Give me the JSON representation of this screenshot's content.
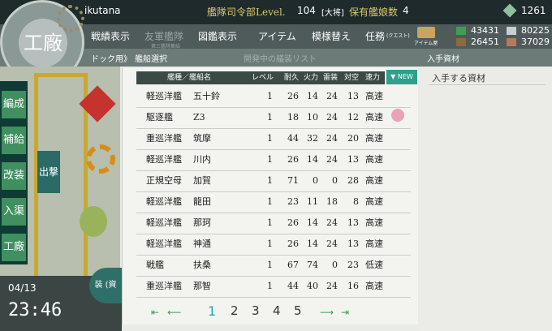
{
  "header": {
    "username": "ikutana",
    "hq_level_label": "艦隊司令部Level.",
    "hq_level_value": "104",
    "rank": "[大将]",
    "ship_count_label": "保有艦娘数",
    "ship_count_value": "4",
    "coins": "1261",
    "resources": {
      "fuel": "43431",
      "ammo": "26451",
      "steel": "80225",
      "bauxite": "37029"
    }
  },
  "side_badge": "工廠",
  "menu": {
    "items": [
      "戦績表示",
      "友軍艦隊",
      "図鑑表示",
      "アイテム",
      "模様替え",
      "任務"
    ],
    "quest_suffix": "(クエスト)",
    "friend_sub": "第三艦隊集結",
    "item_shop": "アイテム屋"
  },
  "subbar": {
    "breadcrumb_prefix": "ドック用》",
    "breadcrumb_current": "艦船選択",
    "center_hint": "開発中の艤装リスト",
    "right_title": "入手資材"
  },
  "left_nav": [
    "編成",
    "補給",
    "改装",
    "入渠",
    "工廠"
  ],
  "left_sub": "出撃",
  "date": "04/13",
  "time": "23:46",
  "equip_btn": "装 (資",
  "table": {
    "headers": {
      "name": "艦種／艦船名",
      "level": "レベル",
      "hp": "耐久",
      "fp": "火力",
      "tp": "雷装",
      "aa": "対空",
      "speed": "速力"
    },
    "sort_label": "NEW",
    "rows": [
      {
        "type": "軽巡洋艦",
        "name": "五十鈴",
        "level": "1",
        "hp": "26",
        "fp": "14",
        "tp": "24",
        "aa": "13",
        "speed": "高速"
      },
      {
        "type": "駆逐艦",
        "name": "Z3",
        "level": "1",
        "hp": "18",
        "fp": "10",
        "tp": "24",
        "aa": "12",
        "speed": "高速"
      },
      {
        "type": "重巡洋艦",
        "name": "筑摩",
        "level": "1",
        "hp": "44",
        "fp": "32",
        "tp": "24",
        "aa": "20",
        "speed": "高速"
      },
      {
        "type": "軽巡洋艦",
        "name": "川内",
        "level": "1",
        "hp": "26",
        "fp": "14",
        "tp": "24",
        "aa": "13",
        "speed": "高速"
      },
      {
        "type": "正規空母",
        "name": "加賀",
        "level": "1",
        "hp": "71",
        "fp": "0",
        "tp": "0",
        "aa": "28",
        "speed": "高速"
      },
      {
        "type": "軽巡洋艦",
        "name": "龍田",
        "level": "1",
        "hp": "23",
        "fp": "11",
        "tp": "18",
        "aa": "8",
        "speed": "高速"
      },
      {
        "type": "軽巡洋艦",
        "name": "那珂",
        "level": "1",
        "hp": "26",
        "fp": "14",
        "tp": "24",
        "aa": "13",
        "speed": "高速"
      },
      {
        "type": "軽巡洋艦",
        "name": "神通",
        "level": "1",
        "hp": "26",
        "fp": "14",
        "tp": "24",
        "aa": "13",
        "speed": "高速"
      },
      {
        "type": "戦艦",
        "name": "扶桑",
        "level": "1",
        "hp": "67",
        "fp": "74",
        "tp": "0",
        "aa": "23",
        "speed": "低速"
      },
      {
        "type": "重巡洋艦",
        "name": "那智",
        "level": "1",
        "hp": "44",
        "fp": "40",
        "tp": "24",
        "aa": "16",
        "speed": "高速"
      }
    ]
  },
  "pager": {
    "pages": [
      "1",
      "2",
      "3",
      "4",
      "5"
    ],
    "current": "1"
  },
  "right": {
    "subtitle": "入手する資材"
  },
  "colors": {
    "header_bg": "#1f2a2c",
    "accent_teal": "#2f9f8e",
    "gold": "#d8c86a"
  }
}
